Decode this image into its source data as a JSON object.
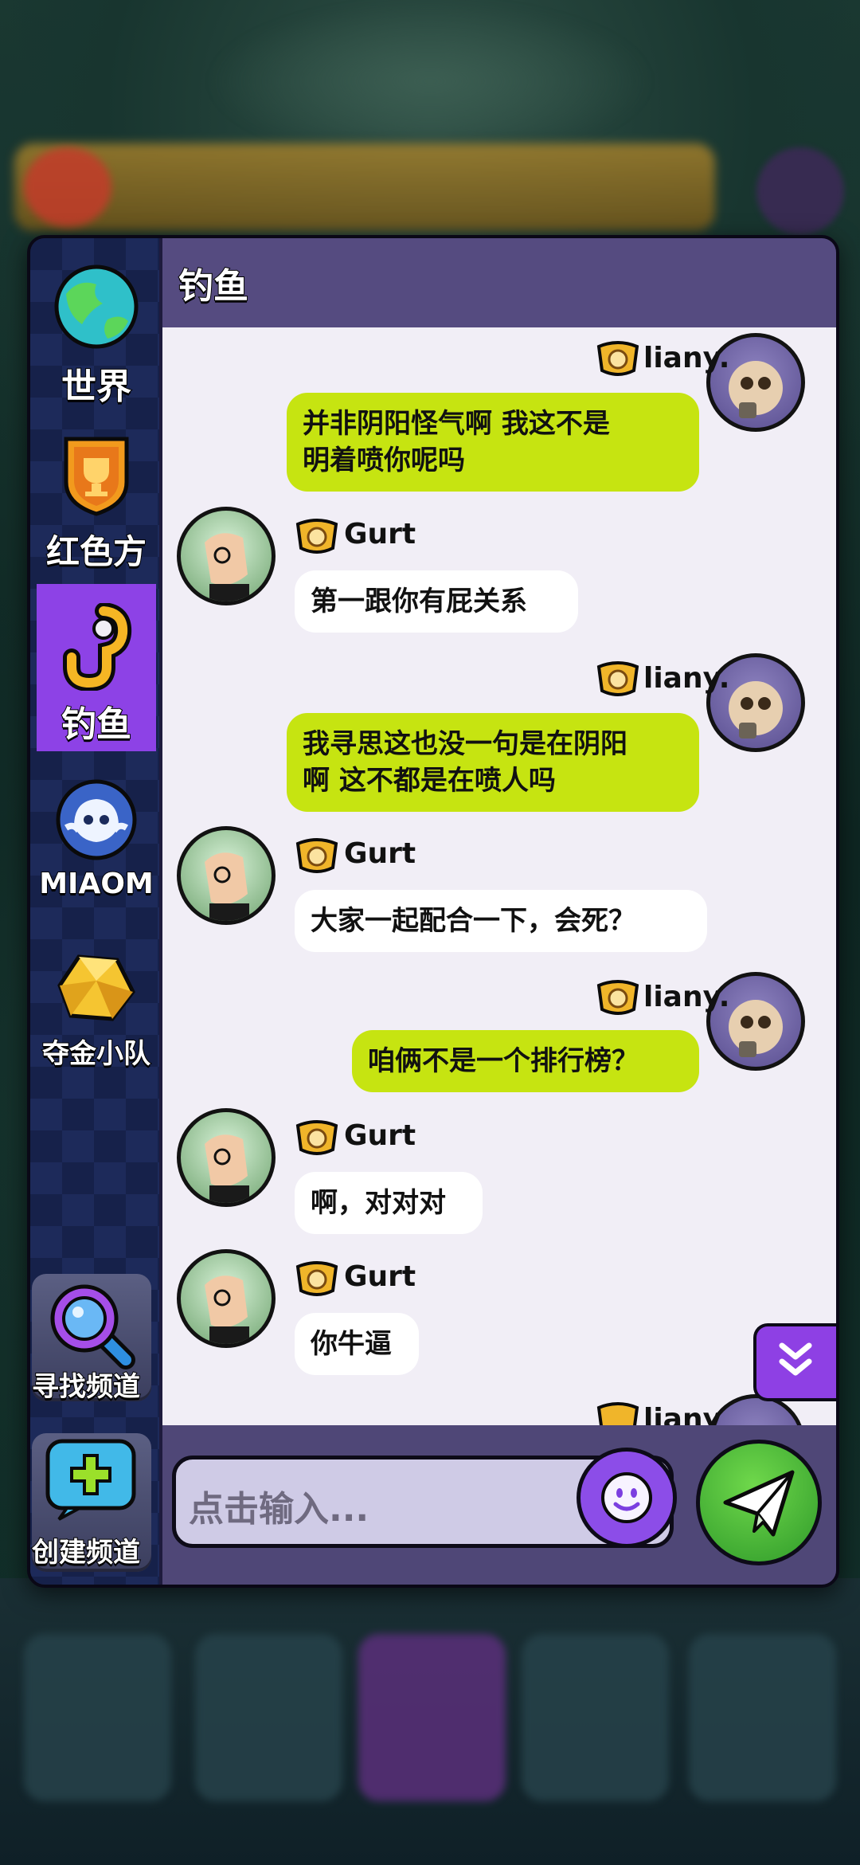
{
  "sidebar": {
    "items": [
      {
        "label": "世界",
        "icon": "globe-icon"
      },
      {
        "label": "红色方",
        "icon": "trophy-shield-icon"
      },
      {
        "label": "钓鱼",
        "icon": "fishing-hook-icon",
        "active": true
      },
      {
        "label": "MIAOM",
        "icon": "ghost-avatar-icon"
      },
      {
        "label": "夺金小队",
        "icon": "gold-nugget-icon"
      }
    ],
    "find_channel_label": "寻找频道",
    "create_channel_label": "创建频道"
  },
  "header": {
    "title": "钓鱼"
  },
  "messages": [
    {
      "sender": "liany.",
      "side": "right",
      "lines": [
        "并非阴阳怪气啊 我这不是",
        "明着喷你呢吗"
      ]
    },
    {
      "sender": "Gurt",
      "side": "left",
      "lines": [
        "第一跟你有屁关系"
      ]
    },
    {
      "sender": "liany.",
      "side": "right",
      "lines": [
        "我寻思这也没一句是在阴阳",
        "啊 这不都是在喷人吗"
      ]
    },
    {
      "sender": "Gurt",
      "side": "left",
      "lines": [
        "大家一起配合一下，会死？"
      ]
    },
    {
      "sender": "liany.",
      "side": "right",
      "lines": [
        "咱俩不是一个排行榜？"
      ]
    },
    {
      "sender": "Gurt",
      "side": "left",
      "lines": [
        "啊，对对对"
      ]
    },
    {
      "sender": "Gurt",
      "side": "left",
      "lines": [
        "你牛逼"
      ]
    },
    {
      "sender": "liany",
      "side": "right",
      "lines": []
    }
  ],
  "input": {
    "placeholder": "点击输入..."
  },
  "colors": {
    "accent": "#8d42e6",
    "my_bubble": "#c6e411",
    "send_button": "#3fb333"
  }
}
